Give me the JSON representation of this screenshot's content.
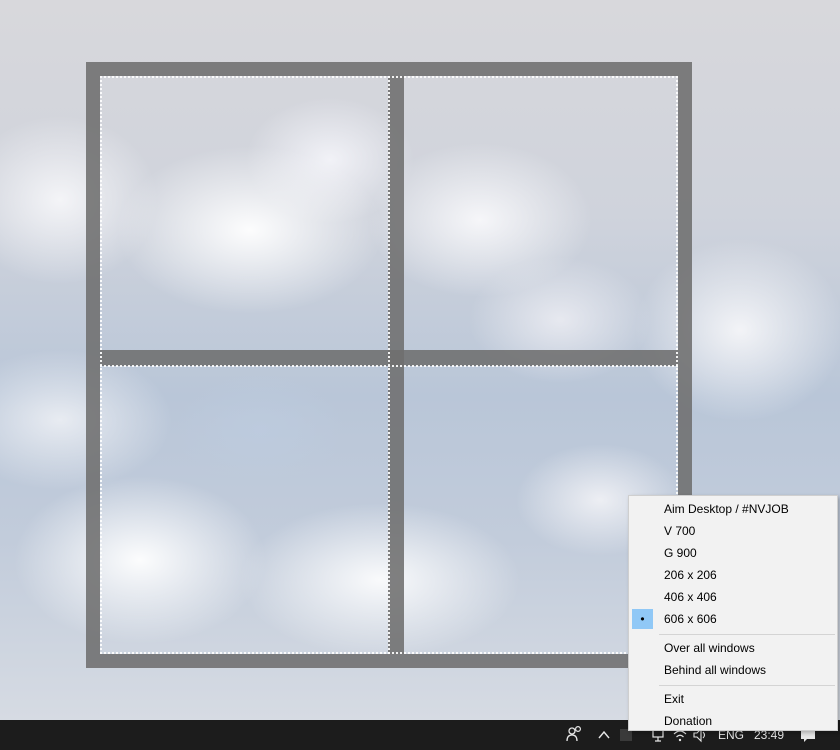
{
  "desktop": {
    "wallpaper": "sky-with-clouds",
    "overlay": {
      "size_label": "606 x 606",
      "frame_color": "#6e6e6e",
      "guide_color": "#ffffff"
    }
  },
  "context_menu": {
    "items": [
      {
        "label": "Aim Desktop / #NVJOB",
        "checked": false
      },
      {
        "label": "V 700",
        "checked": false
      },
      {
        "label": "G 900",
        "checked": false
      },
      {
        "label": "206 x 206",
        "checked": false
      },
      {
        "label": "406 x 406",
        "checked": false
      },
      {
        "label": "606 x 606",
        "checked": true,
        "mark": "•"
      },
      {
        "label": "Over all windows",
        "checked": false
      },
      {
        "label": "Behind all windows",
        "checked": false
      },
      {
        "label": "Exit",
        "checked": false
      },
      {
        "label": "Donation",
        "checked": false
      }
    ],
    "highlight_color": "#90c8f6"
  },
  "taskbar": {
    "background": "#1c1c1c",
    "language": "ENG",
    "time": "23:49",
    "icons": [
      "people-icon",
      "chevron-up-icon",
      "tray-app-icon",
      "network-icon",
      "wifi-icon",
      "volume-icon",
      "notification-icon"
    ]
  }
}
